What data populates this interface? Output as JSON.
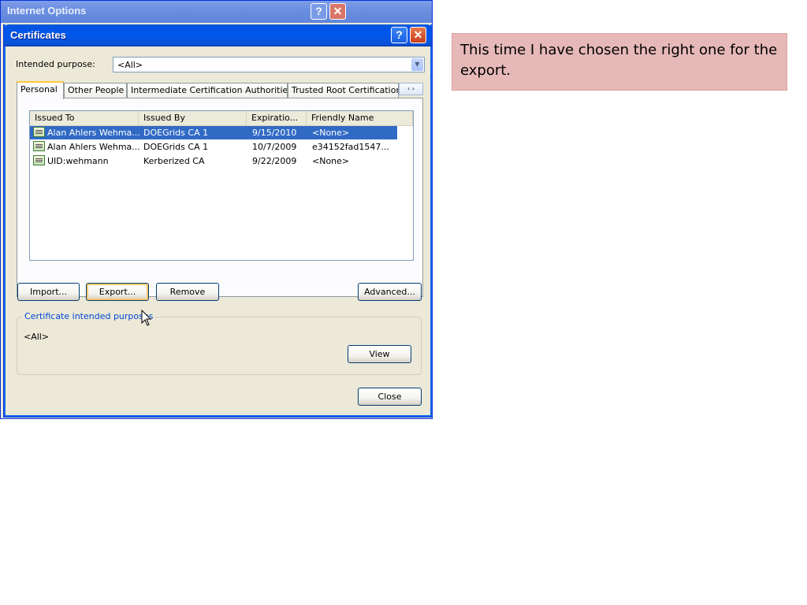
{
  "background_window": {
    "title": "Internet Options",
    "help_glyph": "?",
    "close_glyph": "✕"
  },
  "dialog": {
    "title": "Certificates",
    "help_glyph": "?",
    "close_glyph": "✕",
    "intended_purpose_label": "Intended purpose:",
    "intended_purpose_value": "<All>",
    "tabs": [
      {
        "label": "Personal",
        "active": true
      },
      {
        "label": "Other People",
        "active": false
      },
      {
        "label": "Intermediate Certification Authorities",
        "active": false
      },
      {
        "label": "Trusted Root Certification Authorities",
        "active": false
      }
    ],
    "tab_scroll_glyphs": "‹ ›",
    "columns": [
      "Issued To",
      "Issued By",
      "Expiratio...",
      "Friendly Name"
    ],
    "rows": [
      {
        "issued_to": "Alan Ahlers Wehma...",
        "issued_by": "DOEGrids CA 1",
        "expiration": "9/15/2010",
        "friendly_name": "<None>",
        "selected": true
      },
      {
        "issued_to": "Alan Ahlers Wehma...",
        "issued_by": "DOEGrids CA 1",
        "expiration": "10/7/2009",
        "friendly_name": "e34152fad1547...",
        "selected": false
      },
      {
        "issued_to": "UID:wehmann",
        "issued_by": "Kerberized CA",
        "expiration": "9/22/2009",
        "friendly_name": "<None>",
        "selected": false
      }
    ],
    "buttons": {
      "import": "Import...",
      "export": "Export...",
      "remove": "Remove",
      "advanced": "Advanced...",
      "view": "View",
      "close": "Close"
    },
    "purposes_group_title": "Certificate intended purposes",
    "purposes_value": "<All>"
  },
  "note": {
    "text": "This time I have chosen the right one for the export."
  },
  "colors": {
    "selection": "#316ac5",
    "note_background": "#e6b9b8",
    "title_bar": "#0058ee"
  }
}
